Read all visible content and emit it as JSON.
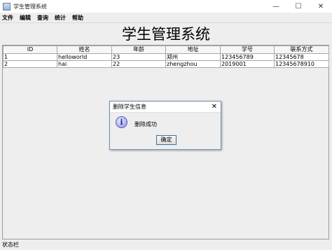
{
  "window": {
    "title": "学生管理系统",
    "controls": [
      "—",
      "☐",
      "✕"
    ]
  },
  "menu": [
    "文件",
    "编辑",
    "查询",
    "统计",
    "帮助"
  ],
  "heading": "学生管理系统",
  "table": {
    "columns": [
      "ID",
      "姓名",
      "年龄",
      "地址",
      "学号",
      "联系方式"
    ],
    "rows": [
      [
        "1",
        "helloworld",
        "23",
        "郑州",
        "123456789",
        "12345678"
      ],
      [
        "2",
        "hai",
        "22",
        "zhengzhou",
        "2019001",
        "12345678910"
      ]
    ]
  },
  "status": "状态栏",
  "dialog": {
    "title": "删除学生信息",
    "close": "✕",
    "icon": "i",
    "message": "删除成功",
    "ok_label": "确定"
  }
}
